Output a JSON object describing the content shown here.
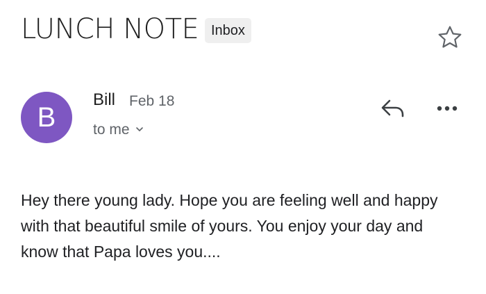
{
  "message": {
    "subject": "LUNCH NOTE",
    "label": "Inbox",
    "sender": {
      "initial": "B",
      "name": "Bill",
      "date": "Feb 18",
      "avatar_color": "#7e57c2"
    },
    "recipient": "to me",
    "body": "Hey there young lady.  Hope you are feeling well and happy with that beautiful smile of yours.  You enjoy your day and know that Papa loves you...."
  },
  "icons": {
    "star": "star-outline-icon",
    "reply": "reply-arrow-icon",
    "more": "more-horizontal-icon",
    "expand": "chevron-down-icon"
  }
}
